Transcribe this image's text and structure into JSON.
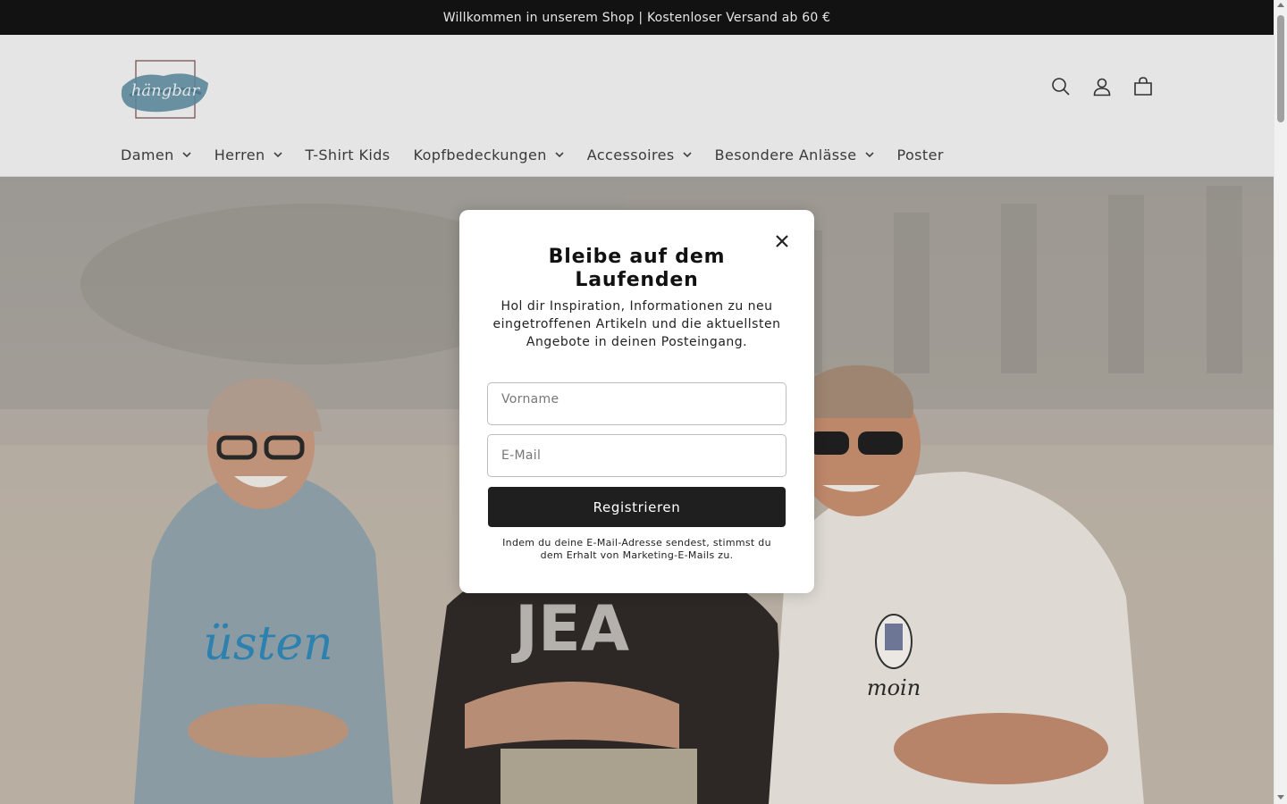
{
  "announcement": {
    "text": "Willkommen in unserem Shop | Kostenloser Versand ab 60 €"
  },
  "header": {
    "logo_text": "hängbar",
    "icons": [
      "search-icon",
      "account-icon",
      "cart-icon"
    ]
  },
  "nav": {
    "items": [
      {
        "label": "Damen",
        "has_dropdown": true
      },
      {
        "label": "Herren",
        "has_dropdown": true
      },
      {
        "label": "T-Shirt Kids",
        "has_dropdown": false
      },
      {
        "label": "Kopfbedeckungen",
        "has_dropdown": true
      },
      {
        "label": "Accessoires",
        "has_dropdown": true
      },
      {
        "label": "Besondere Anlässe",
        "has_dropdown": true
      },
      {
        "label": "Poster",
        "has_dropdown": false
      }
    ]
  },
  "modal": {
    "title": "Bleibe auf dem Laufenden",
    "text": "Hol dir Inspiration, Informationen zu neu eingetroffenen Artikeln und die aktuellsten Angebote in deinen Posteingang.",
    "firstname_placeholder": "Vorname",
    "email_placeholder": "E-Mail",
    "button_label": "Registrieren",
    "note": "Indem du deine E-Mail-Adresse sendest, stimmst du dem Erhalt von Marketing-E-Mails zu."
  },
  "colors": {
    "announcement_bg": "#121212",
    "button_bg": "#1f1f1f",
    "page_bg": "#f3f3f3"
  }
}
